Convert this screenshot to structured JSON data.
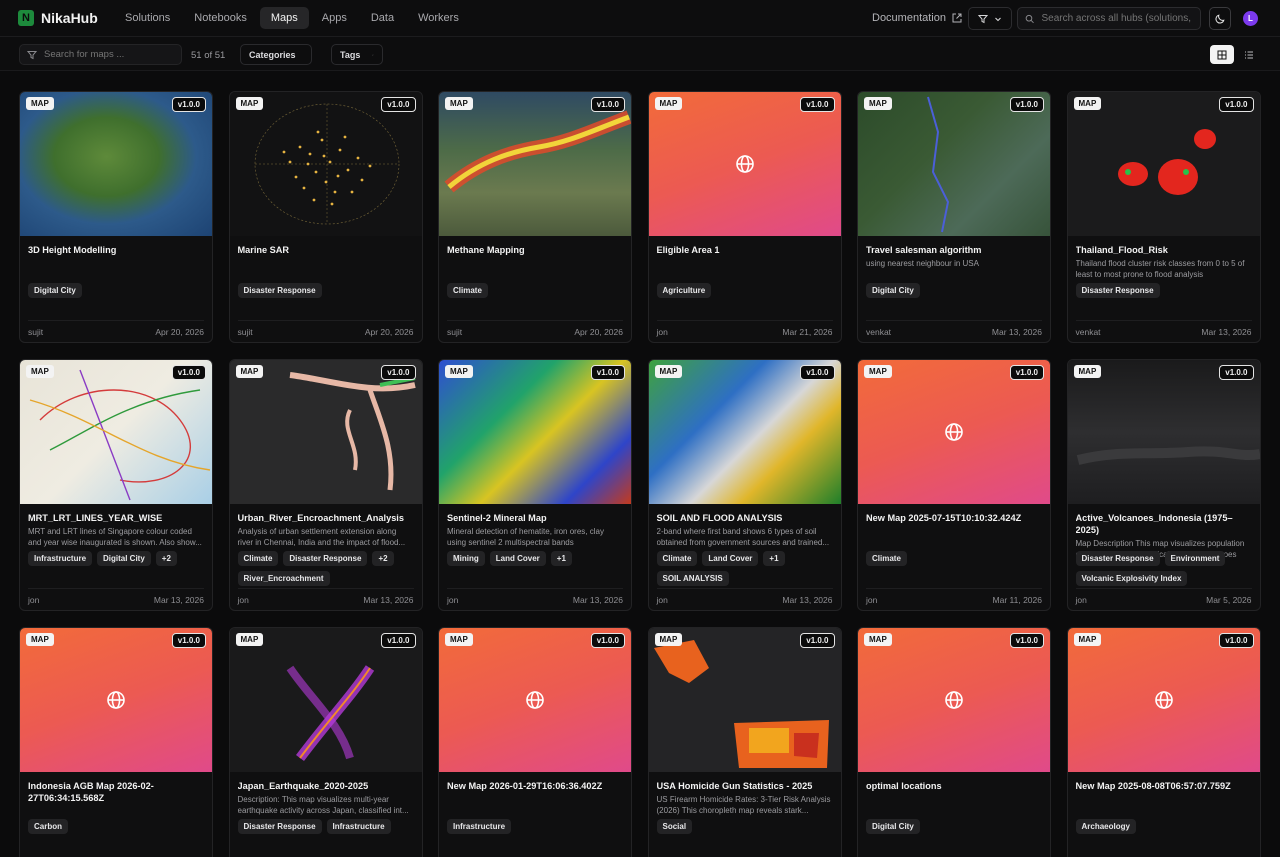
{
  "app": {
    "logo_letter": "N",
    "name": "NikaHub"
  },
  "nav": [
    {
      "label": "Solutions",
      "active": false
    },
    {
      "label": "Notebooks",
      "active": false
    },
    {
      "label": "Maps",
      "active": true
    },
    {
      "label": "Apps",
      "active": false
    },
    {
      "label": "Data",
      "active": false
    },
    {
      "label": "Workers",
      "active": false
    }
  ],
  "header": {
    "documentation_label": "Documentation",
    "global_search_placeholder": "Search across all hubs (solutions, notebooks...)",
    "avatar_letter": "L"
  },
  "toolbar": {
    "search_placeholder": "Search for maps ...",
    "count": "51 of 51",
    "categories_label": "Categories",
    "tags_label": "Tags"
  },
  "colors": {
    "accent_green": "#1d8a3c",
    "avatar_purple": "#7c3aed",
    "placeholder_gradient_start": "#f26b3a",
    "placeholder_gradient_end": "#e04a8a"
  },
  "cards": [
    {
      "badge": "MAP",
      "version": "v1.0.0",
      "title": "3D Height Modelling",
      "description": "",
      "tags": [
        "Digital City"
      ],
      "author": "sujit",
      "date": "Apr 20, 2026",
      "thumb": "t-3d"
    },
    {
      "badge": "MAP",
      "version": "v1.0.0",
      "title": "Marine SAR",
      "description": "",
      "tags": [
        "Disaster Response"
      ],
      "author": "sujit",
      "date": "Apr 20, 2026",
      "thumb": "t-marine"
    },
    {
      "badge": "MAP",
      "version": "v1.0.0",
      "title": "Methane Mapping",
      "description": "",
      "tags": [
        "Climate"
      ],
      "author": "sujit",
      "date": "Apr 20, 2026",
      "thumb": "t-methane"
    },
    {
      "badge": "MAP",
      "version": "v1.0.0",
      "title": "Eligible Area 1",
      "description": "",
      "tags": [
        "Agriculture"
      ],
      "author": "jon",
      "date": "Mar 21, 2026",
      "thumb": "grad"
    },
    {
      "badge": "MAP",
      "version": "v1.0.0",
      "title": "Travel salesman algorithm",
      "description": "using nearest neighbour in USA",
      "tags": [
        "Digital City"
      ],
      "author": "venkat",
      "date": "Mar 13, 2026",
      "thumb": "t-travel"
    },
    {
      "badge": "MAP",
      "version": "v1.0.0",
      "title": "Thailand_Flood_Risk",
      "description": "Thailand flood cluster risk classes from 0 to 5 of least to most prone to flood analysis",
      "tags": [
        "Disaster Response"
      ],
      "author": "venkat",
      "date": "Mar 13, 2026",
      "thumb": "t-flood"
    },
    {
      "badge": "MAP",
      "version": "v1.0.0",
      "title": "MRT_LRT_LINES_YEAR_WISE",
      "description": "MRT and LRT lines of Singapore colour coded and year wise inaugurated is shown. Also show...",
      "tags": [
        "Infrastructure",
        "Digital City",
        "+2"
      ],
      "author": "jon",
      "date": "Mar 13, 2026",
      "thumb": "t-mrt"
    },
    {
      "badge": "MAP",
      "version": "v1.0.0",
      "title": "Urban_River_Encroachment_Analysis",
      "description": "Analysis of urban settlement extension along river in Chennai, India and the impact of flood...",
      "tags": [
        "Climate",
        "Disaster Response",
        "+2",
        "River_Encroachment"
      ],
      "author": "jon",
      "date": "Mar 13, 2026",
      "thumb": "t-river"
    },
    {
      "badge": "MAP",
      "version": "v1.0.0",
      "title": "Sentinel-2 Mineral Map",
      "description": "Mineral detection of hematite, iron ores, clay using sentinel 2 multispectral bands",
      "tags": [
        "Mining",
        "Land Cover",
        "+1"
      ],
      "author": "jon",
      "date": "Mar 13, 2026",
      "thumb": "t-sentinel"
    },
    {
      "badge": "MAP",
      "version": "v1.0.0",
      "title": "SOIL AND FLOOD ANALYSIS",
      "description": "2-band where first band shows 6 types of soil obtained from government sources and trained...",
      "tags": [
        "Climate",
        "Land Cover",
        "+1",
        "SOIL ANALYSIS"
      ],
      "author": "jon",
      "date": "Mar 13, 2026",
      "thumb": "t-soil"
    },
    {
      "badge": "MAP",
      "version": "v1.0.0",
      "title": "New Map 2025-07-15T10:10:32.424Z",
      "description": "",
      "tags": [
        "Climate"
      ],
      "author": "jon",
      "date": "Mar 11, 2026",
      "thumb": "grad"
    },
    {
      "badge": "MAP",
      "version": "v1.0.0",
      "title": "Active_Volcanoes_Indonesia (1975–2025)",
      "description": "Map Description This map visualizes population exposure around historically active volcanoes in...",
      "tags": [
        "Disaster Response",
        "Environment",
        "Volcanic Explosivity Index"
      ],
      "author": "jon",
      "date": "Mar 5, 2026",
      "thumb": "t-volcano"
    },
    {
      "badge": "MAP",
      "version": "v1.0.0",
      "title": "Indonesia AGB Map 2026-02-27T06:34:15.568Z",
      "description": "",
      "tags": [
        "Carbon"
      ],
      "author": "",
      "date": "",
      "thumb": "grad"
    },
    {
      "badge": "MAP",
      "version": "v1.0.0",
      "title": "Japan_Earthquake_2020-2025",
      "description": "Description: This map visualizes multi-year earthquake activity across Japan, classified int...",
      "tags": [
        "Disaster Response",
        "Infrastructure"
      ],
      "author": "",
      "date": "",
      "thumb": "t-japan"
    },
    {
      "badge": "MAP",
      "version": "v1.0.0",
      "title": "New Map 2026-01-29T16:06:36.402Z",
      "description": "",
      "tags": [
        "Infrastructure"
      ],
      "author": "",
      "date": "",
      "thumb": "grad"
    },
    {
      "badge": "MAP",
      "version": "v1.0.0",
      "title": "USA Homicide Gun Statistics - 2025",
      "description": "US Firearm Homicide Rates: 3-Tier Risk Analysis (2026) This choropleth map reveals stark...",
      "tags": [
        "Social"
      ],
      "author": "",
      "date": "",
      "thumb": "t-usa"
    },
    {
      "badge": "MAP",
      "version": "v1.0.0",
      "title": "optimal locations",
      "description": "",
      "tags": [
        "Digital City"
      ],
      "author": "",
      "date": "",
      "thumb": "grad"
    },
    {
      "badge": "MAP",
      "version": "v1.0.0",
      "title": "New Map 2025-08-08T06:57:07.759Z",
      "description": "",
      "tags": [
        "Archaeology"
      ],
      "author": "",
      "date": "",
      "thumb": "grad"
    }
  ]
}
